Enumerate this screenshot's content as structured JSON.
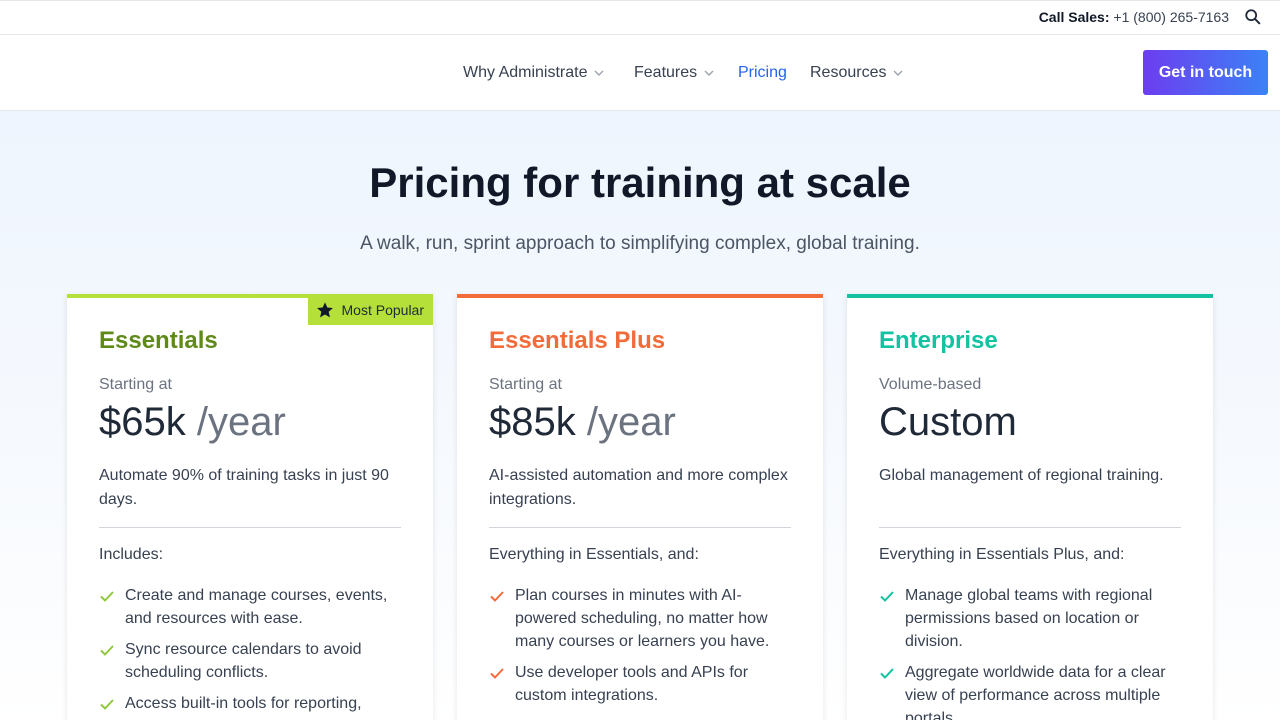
{
  "topbar": {
    "call_label": "Call Sales:",
    "phone": "+1 (800) 265-7163",
    "search_icon": "search-icon"
  },
  "nav": {
    "items": [
      {
        "label": "Why Administrate",
        "has_dropdown": true
      },
      {
        "label": "Features",
        "has_dropdown": true
      },
      {
        "label": "Pricing",
        "has_dropdown": false,
        "active": true
      },
      {
        "label": "Resources",
        "has_dropdown": true
      }
    ],
    "cta_label": "Get in touch"
  },
  "hero": {
    "title": "Pricing for training at scale",
    "subtitle": "A walk, run, sprint approach to simplifying complex, global training."
  },
  "colors": {
    "essentials": "#5f8a19",
    "essentials_bar": "#b5e03a",
    "essentials_plus": "#f26b3a",
    "enterprise": "#13c2a0",
    "active_nav": "#2563eb",
    "cta_gradient": [
      "#6d3df0",
      "#3b82f6"
    ]
  },
  "plans": [
    {
      "name": "Essentials",
      "badge": "Most Popular",
      "pre_price": "Starting at",
      "price": "$65k",
      "unit": "/year",
      "description": "Automate 90% of training tasks in just 90 days.",
      "includes": "Includes:",
      "features": [
        "Create and manage courses, events, and resources with ease.",
        "Sync resource calendars to avoid scheduling conflicts.",
        "Access built-in tools for reporting,"
      ]
    },
    {
      "name": "Essentials Plus",
      "pre_price": "Starting at",
      "price": "$85k",
      "unit": "/year",
      "description": "AI-assisted automation and more complex integrations.",
      "includes": "Everything in Essentials, and:",
      "features": [
        "Plan courses in minutes with AI-powered scheduling, no matter how many courses or learners you have.",
        "Use developer tools and APIs for custom integrations."
      ]
    },
    {
      "name": "Enterprise",
      "pre_price": "Volume-based",
      "price": "Custom",
      "unit": "",
      "description": "Global management of regional training.",
      "includes": "Everything in Essentials Plus, and:",
      "features": [
        "Manage global teams with regional permissions based on location or division.",
        "Aggregate worldwide data for a clear view of performance across multiple portals."
      ]
    }
  ]
}
